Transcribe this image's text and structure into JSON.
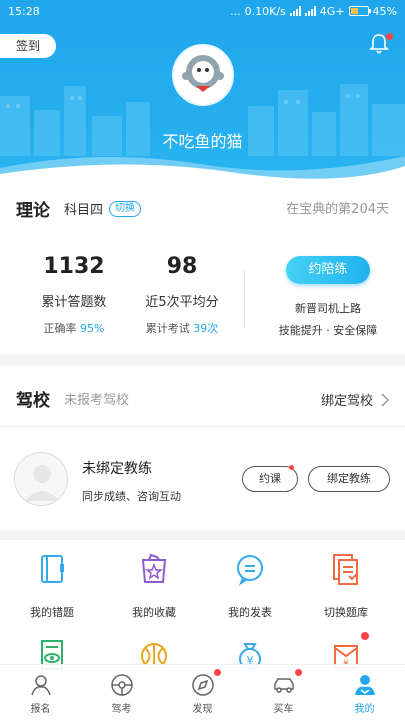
{
  "status_bar": {
    "time": "15:28",
    "dots": "...",
    "network_speed": "0.10K/s",
    "network_type": "4G+",
    "battery_percent": "45%",
    "battery_level": 0.45
  },
  "header": {
    "checkin_label": "签到",
    "nickname": "不吃鱼的猫",
    "bell_icon": "bell-icon",
    "bell_has_badge": true
  },
  "theory": {
    "title": "理论",
    "subject": "科目四",
    "switch_label": "切换",
    "days_text": "在宝典的第204天",
    "stats": [
      {
        "value": "1132",
        "label": "累计答题数",
        "sub_prefix": "正确率",
        "sub_value": "95%"
      },
      {
        "value": "98",
        "label": "近5次平均分",
        "sub_prefix": "累计考试",
        "sub_value": "39次"
      }
    ],
    "accompany_button": "约陪练",
    "promo_line1": "新晋司机上路",
    "promo_line2": "技能提升 · 安全保障"
  },
  "school": {
    "title": "驾校",
    "status": "未报考驾校",
    "bind_label": "绑定驾校",
    "coach_name": "未绑定教练",
    "coach_desc": "同步成绩、咨询互动",
    "book_label": "约课",
    "bind_coach_label": "绑定教练"
  },
  "features": [
    {
      "label": "我的错题",
      "icon": "notebook-icon"
    },
    {
      "label": "我的收藏",
      "icon": "star-bag-icon"
    },
    {
      "label": "我的发表",
      "icon": "chat-bubble-icon"
    },
    {
      "label": "切换题库",
      "icon": "document-stack-icon"
    },
    {
      "label": "",
      "icon": "eye-document-icon"
    },
    {
      "label": "",
      "icon": "basketball-icon"
    },
    {
      "label": "",
      "icon": "money-bag-icon"
    },
    {
      "label": "",
      "icon": "red-envelope-icon"
    }
  ],
  "tabs": [
    {
      "label": "报名",
      "icon": "signup-icon",
      "active": false,
      "badge": false
    },
    {
      "label": "驾考",
      "icon": "steering-wheel-icon",
      "active": false,
      "badge": false
    },
    {
      "label": "发现",
      "icon": "discover-icon",
      "active": false,
      "badge": true
    },
    {
      "label": "买车",
      "icon": "car-icon",
      "active": false,
      "badge": true
    },
    {
      "label": "我的",
      "icon": "profile-icon",
      "active": true,
      "badge": false
    }
  ],
  "colors": {
    "accent": "#24a9ee",
    "header_bg": "#22aaed",
    "badge": "#ff4444"
  }
}
